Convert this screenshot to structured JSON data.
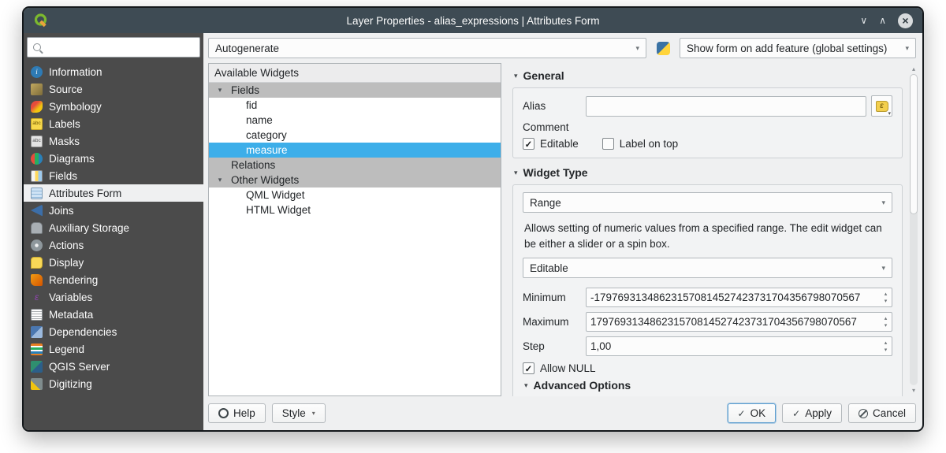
{
  "window": {
    "title": "Layer Properties - alias_expressions | Attributes Form"
  },
  "sidebar": {
    "search_value": "",
    "items": [
      {
        "label": "Information",
        "icon": "information-icon"
      },
      {
        "label": "Source",
        "icon": "source-icon"
      },
      {
        "label": "Symbology",
        "icon": "symbology-icon"
      },
      {
        "label": "Labels",
        "icon": "labels-icon"
      },
      {
        "label": "Masks",
        "icon": "masks-icon"
      },
      {
        "label": "Diagrams",
        "icon": "diagrams-icon"
      },
      {
        "label": "Fields",
        "icon": "fields-icon"
      },
      {
        "label": "Attributes Form",
        "icon": "attributes-form-icon",
        "selected": true
      },
      {
        "label": "Joins",
        "icon": "joins-icon"
      },
      {
        "label": "Auxiliary Storage",
        "icon": "auxiliary-storage-icon"
      },
      {
        "label": "Actions",
        "icon": "actions-icon"
      },
      {
        "label": "Display",
        "icon": "display-icon"
      },
      {
        "label": "Rendering",
        "icon": "rendering-icon"
      },
      {
        "label": "Variables",
        "icon": "variables-icon"
      },
      {
        "label": "Metadata",
        "icon": "metadata-icon"
      },
      {
        "label": "Dependencies",
        "icon": "dependencies-icon"
      },
      {
        "label": "Legend",
        "icon": "legend-icon"
      },
      {
        "label": "QGIS Server",
        "icon": "qgis-server-icon"
      },
      {
        "label": "Digitizing",
        "icon": "digitizing-icon"
      }
    ]
  },
  "toolbar": {
    "layout_combo_value": "Autogenerate",
    "python_button_icon": "python-icon",
    "show_form_combo_value": "Show form on add feature (global settings)"
  },
  "widgets_panel": {
    "title": "Available Widgets",
    "tree": [
      {
        "label": "Fields",
        "type": "group",
        "expanded": true
      },
      {
        "label": "fid",
        "type": "item"
      },
      {
        "label": "name",
        "type": "item"
      },
      {
        "label": "category",
        "type": "item"
      },
      {
        "label": "measure",
        "type": "item",
        "selected": true
      },
      {
        "label": "Relations",
        "type": "group",
        "expanded": false
      },
      {
        "label": "Other Widgets",
        "type": "group",
        "expanded": true
      },
      {
        "label": "QML Widget",
        "type": "item"
      },
      {
        "label": "HTML Widget",
        "type": "item"
      }
    ]
  },
  "general": {
    "title": "General",
    "alias_label": "Alias",
    "alias_value": "",
    "comment_label": "Comment",
    "editable_label": "Editable",
    "editable_checked": true,
    "label_on_top_label": "Label on top",
    "label_on_top_checked": false
  },
  "widget_type": {
    "title": "Widget Type",
    "type_value": "Range",
    "description": "Allows setting of numeric values from a specified range. The edit widget can be either a slider or a spin box.",
    "mode_value": "Editable",
    "minimum_label": "Minimum",
    "minimum_value": "-179769313486231570814527423731704356798070567",
    "maximum_label": "Maximum",
    "maximum_value": "179769313486231570814527423731704356798070567",
    "step_label": "Step",
    "step_value": "1,00",
    "allow_null_label": "Allow NULL",
    "allow_null_checked": true,
    "advanced_title": "Advanced Options"
  },
  "footer": {
    "help": "Help",
    "style": "Style",
    "ok": "OK",
    "apply": "Apply",
    "cancel": "Cancel"
  },
  "icons": {
    "qgis-logo": "green Q with yellow arrow",
    "search-icon": "magnifier",
    "python-icon": "python logo blue/yellow",
    "expression-icon": "yellow epsilon tag",
    "chevron-down-icon": "triangle down",
    "spinner-icons": "triangles up/down",
    "minimize-icon": "chevron down",
    "maximize-icon": "chevron up",
    "close-icon": "circled x",
    "help-icon": "life buoy ring",
    "ok-icon": "check mark",
    "apply-icon": "check mark",
    "cancel-icon": "slashed circle"
  }
}
